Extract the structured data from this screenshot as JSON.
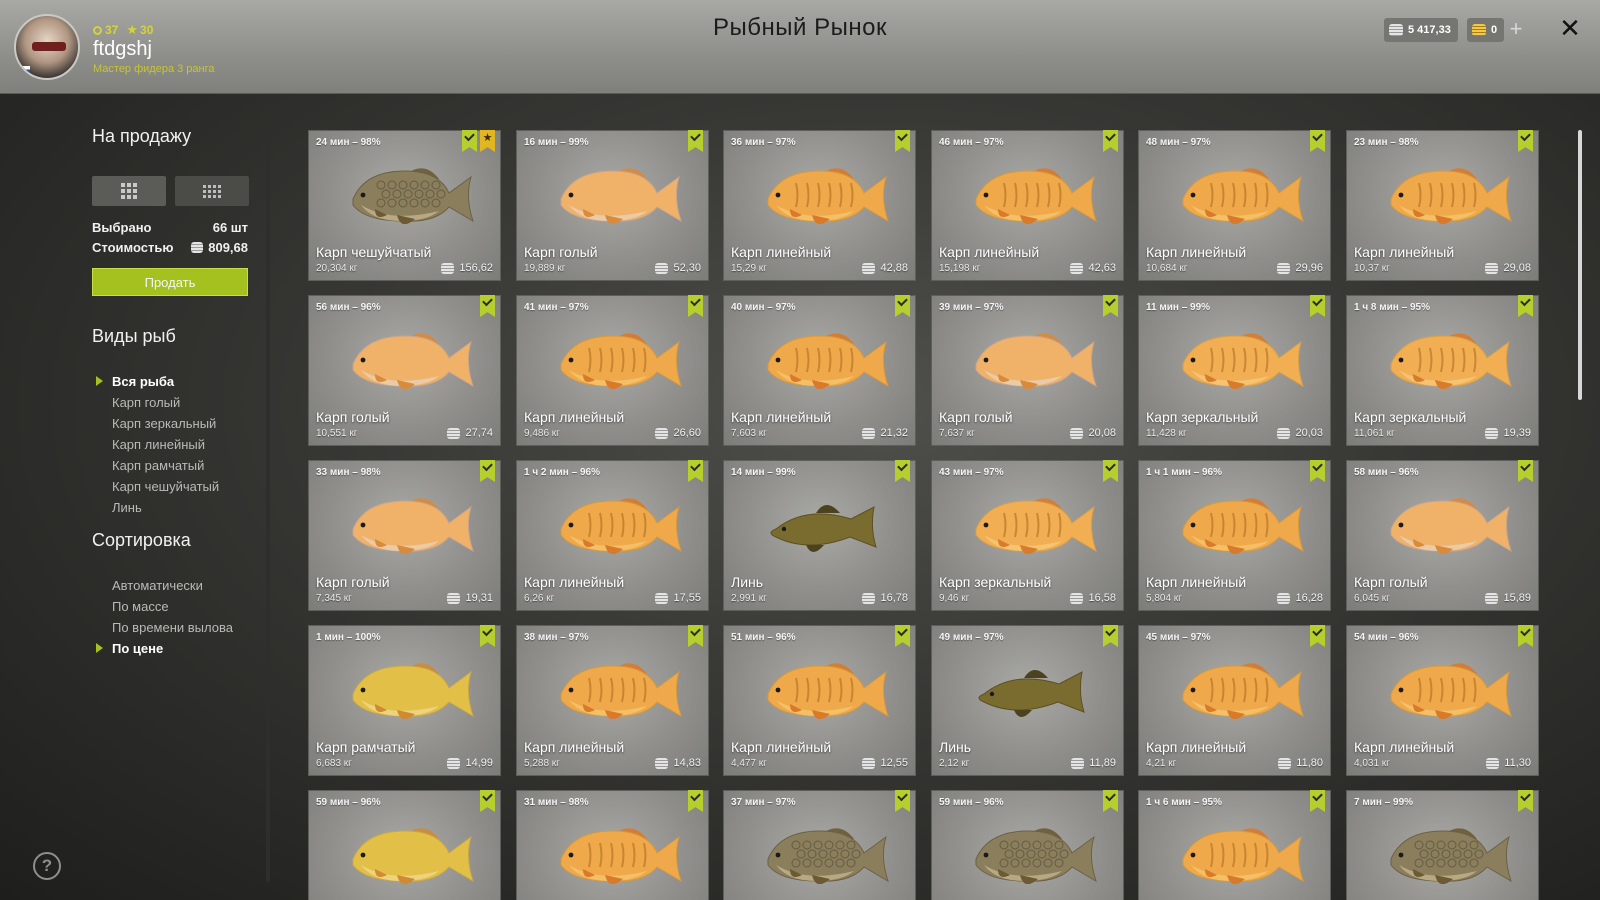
{
  "header": {
    "title": "Рыбный Рынок",
    "level": "37",
    "stars": "30",
    "username": "ftdgshj",
    "rank": "Мастер фидера 3 ранга",
    "silver": "5 417,33",
    "gold": "0"
  },
  "sidebar": {
    "for_sale_title": "На продажу",
    "selected_label": "Выбрано",
    "selected_value": "66 шт",
    "cost_label": "Стоимостью",
    "cost_value": "809,68",
    "sell_label": "Продать",
    "species_title": "Виды рыб",
    "species": [
      {
        "label": "Вся рыба",
        "selected": true
      },
      {
        "label": "Карп голый",
        "selected": false
      },
      {
        "label": "Карп зеркальный",
        "selected": false
      },
      {
        "label": "Карп линейный",
        "selected": false
      },
      {
        "label": "Карп рамчатый",
        "selected": false
      },
      {
        "label": "Карп чешуйчатый",
        "selected": false
      },
      {
        "label": "Линь",
        "selected": false
      }
    ],
    "sort_title": "Сортировка",
    "sort": [
      {
        "label": "Автоматически",
        "selected": false
      },
      {
        "label": "По массе",
        "selected": false
      },
      {
        "label": "По времени вылова",
        "selected": false
      },
      {
        "label": "По цене",
        "selected": true
      }
    ]
  },
  "colors": {
    "accent": "#a4c120",
    "flag": "#b6cf2c",
    "star_flag": "#e2b621",
    "card": "#908f8c"
  },
  "fish": [
    {
      "time": "24 мин – 98%",
      "name": "Карп чешуйчатый",
      "weight": "20,304 кг",
      "price": "156,62",
      "kind": "scaled",
      "favorite": true
    },
    {
      "time": "16 мин – 99%",
      "name": "Карп голый",
      "weight": "19,889 кг",
      "price": "52,30",
      "kind": "leather",
      "favorite": false
    },
    {
      "time": "36 мин – 97%",
      "name": "Карп линейный",
      "weight": "15,29 кг",
      "price": "42,88",
      "kind": "linear",
      "favorite": false
    },
    {
      "time": "46 мин – 97%",
      "name": "Карп линейный",
      "weight": "15,198 кг",
      "price": "42,63",
      "kind": "linear",
      "favorite": false
    },
    {
      "time": "48 мин – 97%",
      "name": "Карп линейный",
      "weight": "10,684 кг",
      "price": "29,96",
      "kind": "linear",
      "favorite": false
    },
    {
      "time": "23 мин – 98%",
      "name": "Карп линейный",
      "weight": "10,37 кг",
      "price": "29,08",
      "kind": "linear",
      "favorite": false
    },
    {
      "time": "56 мин – 96%",
      "name": "Карп голый",
      "weight": "10,551 кг",
      "price": "27,74",
      "kind": "leather",
      "favorite": false
    },
    {
      "time": "41 мин – 97%",
      "name": "Карп линейный",
      "weight": "9,486 кг",
      "price": "26,60",
      "kind": "linear",
      "favorite": false
    },
    {
      "time": "40 мин – 97%",
      "name": "Карп линейный",
      "weight": "7,603 кг",
      "price": "21,32",
      "kind": "linear",
      "favorite": false
    },
    {
      "time": "39 мин – 97%",
      "name": "Карп голый",
      "weight": "7,637 кг",
      "price": "20,08",
      "kind": "leather",
      "favorite": false
    },
    {
      "time": "11 мин – 99%",
      "name": "Карп зеркальный",
      "weight": "11,428 кг",
      "price": "20,03",
      "kind": "mirror",
      "favorite": false
    },
    {
      "time": "1 ч 8 мин – 95%",
      "name": "Карп зеркальный",
      "weight": "11,061 кг",
      "price": "19,39",
      "kind": "mirror",
      "favorite": false
    },
    {
      "time": "33 мин – 98%",
      "name": "Карп голый",
      "weight": "7,345 кг",
      "price": "19,31",
      "kind": "leather",
      "favorite": false
    },
    {
      "time": "1 ч 2 мин – 96%",
      "name": "Карп линейный",
      "weight": "6,26 кг",
      "price": "17,55",
      "kind": "linear",
      "favorite": false
    },
    {
      "time": "14 мин – 99%",
      "name": "Линь",
      "weight": "2,991 кг",
      "price": "16,78",
      "kind": "tench",
      "favorite": false
    },
    {
      "time": "43 мин – 97%",
      "name": "Карп зеркальный",
      "weight": "9,46 кг",
      "price": "16,58",
      "kind": "mirror",
      "favorite": false
    },
    {
      "time": "1 ч 1 мин – 96%",
      "name": "Карп линейный",
      "weight": "5,804 кг",
      "price": "16,28",
      "kind": "linear",
      "favorite": false
    },
    {
      "time": "58 мин – 96%",
      "name": "Карп голый",
      "weight": "6,045 кг",
      "price": "15,89",
      "kind": "leather",
      "favorite": false
    },
    {
      "time": "1 мин – 100%",
      "name": "Карп рамчатый",
      "weight": "6,683 кг",
      "price": "14,99",
      "kind": "frame",
      "favorite": false
    },
    {
      "time": "38 мин – 97%",
      "name": "Карп линейный",
      "weight": "5,288 кг",
      "price": "14,83",
      "kind": "linear",
      "favorite": false
    },
    {
      "time": "51 мин – 96%",
      "name": "Карп линейный",
      "weight": "4,477 кг",
      "price": "12,55",
      "kind": "linear",
      "favorite": false
    },
    {
      "time": "49 мин – 97%",
      "name": "Линь",
      "weight": "2,12 кг",
      "price": "11,89",
      "kind": "tench",
      "favorite": false
    },
    {
      "time": "45 мин – 97%",
      "name": "Карп линейный",
      "weight": "4,21 кг",
      "price": "11,80",
      "kind": "linear",
      "favorite": false
    },
    {
      "time": "54 мин – 96%",
      "name": "Карп линейный",
      "weight": "4,031 кг",
      "price": "11,30",
      "kind": "linear",
      "favorite": false
    },
    {
      "time": "59 мин – 96%",
      "name": "",
      "weight": "",
      "price": "",
      "kind": "frame",
      "favorite": false
    },
    {
      "time": "31 мин – 98%",
      "name": "",
      "weight": "",
      "price": "",
      "kind": "linear",
      "favorite": false
    },
    {
      "time": "37 мин – 97%",
      "name": "",
      "weight": "",
      "price": "",
      "kind": "scaled",
      "favorite": false
    },
    {
      "time": "59 мин – 96%",
      "name": "",
      "weight": "",
      "price": "",
      "kind": "scaled",
      "favorite": false
    },
    {
      "time": "1 ч 6 мин – 95%",
      "name": "",
      "weight": "",
      "price": "",
      "kind": "linear",
      "favorite": false
    },
    {
      "time": "7 мин – 99%",
      "name": "",
      "weight": "",
      "price": "",
      "kind": "scaled",
      "favorite": false
    }
  ]
}
